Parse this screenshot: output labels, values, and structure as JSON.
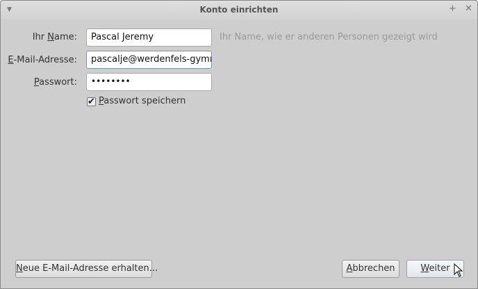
{
  "window": {
    "title": "Konto einrichten"
  },
  "form": {
    "name": {
      "pre": "Ihr ",
      "key": "N",
      "post": "ame:",
      "value": "Pascal Jeremy",
      "hint": "Ihr Name, wie er anderen Personen gezeigt wird"
    },
    "email": {
      "pre": "",
      "key": "E",
      "post": "-Mail-Adresse:",
      "value": "pascalje@werdenfels-gymnas"
    },
    "password": {
      "pre": "",
      "key": "P",
      "post": "asswort:",
      "value": "••••••••"
    },
    "remember": {
      "key": "P",
      "post": "asswort speichern",
      "checked": true
    }
  },
  "buttons": {
    "new_address": {
      "key": "N",
      "post": "eue E-Mail-Adresse erhalten..."
    },
    "cancel": {
      "key": "A",
      "post": "bbrechen"
    },
    "next": {
      "key": "W",
      "post": "eiter"
    }
  }
}
